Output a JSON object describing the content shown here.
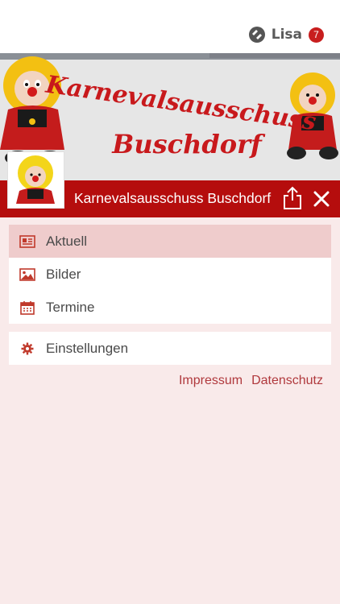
{
  "user": {
    "name": "Lisa",
    "badge_count": "7"
  },
  "banner": {
    "line1": "Karnevalsausschuss",
    "line2": "Buschdorf"
  },
  "header": {
    "club_name": "Karnevalsausschuss Buschdorf"
  },
  "menu": {
    "items": [
      {
        "label": "Aktuell",
        "icon": "newspaper-icon",
        "active": true
      },
      {
        "label": "Bilder",
        "icon": "image-icon",
        "active": false
      },
      {
        "label": "Termine",
        "icon": "calendar-icon",
        "active": false
      }
    ],
    "settings": {
      "label": "Einstellungen",
      "icon": "gear-icon"
    }
  },
  "footer": {
    "impressum": "Impressum",
    "datenschutz": "Datenschutz"
  },
  "colors": {
    "accent": "#b50d0d",
    "background": "#f9eaea",
    "active_item": "#efcccc",
    "link": "#b0393d"
  }
}
